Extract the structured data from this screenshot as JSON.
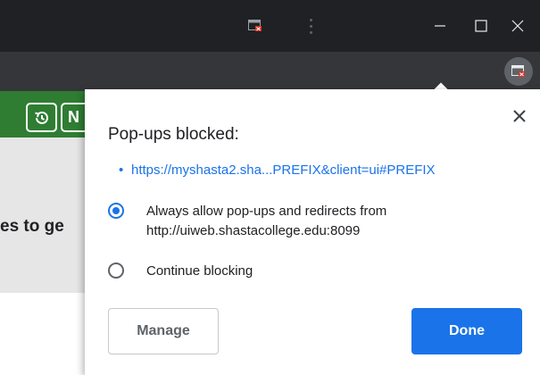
{
  "titlebar": {
    "icons": [
      "popup-blocked-icon",
      "kebab-menu-icon",
      "minimize-icon",
      "maximize-icon",
      "close-icon"
    ]
  },
  "page": {
    "partial_text": "es to ge"
  },
  "bubble": {
    "title": "Pop-ups blocked:",
    "blocked_link": "https://myshasta2.sha...PREFIX&client=ui#PREFIX",
    "options": [
      {
        "label": "Always allow pop-ups and redirects from http://uiweb.shastacollege.edu:8099",
        "selected": true
      },
      {
        "label": "Continue blocking",
        "selected": false
      }
    ],
    "manage_label": "Manage",
    "done_label": "Done"
  },
  "colors": {
    "accent": "#1a73e8",
    "titlebar": "#202124",
    "toolbar": "#35363a",
    "site_green": "#2e7d32"
  }
}
